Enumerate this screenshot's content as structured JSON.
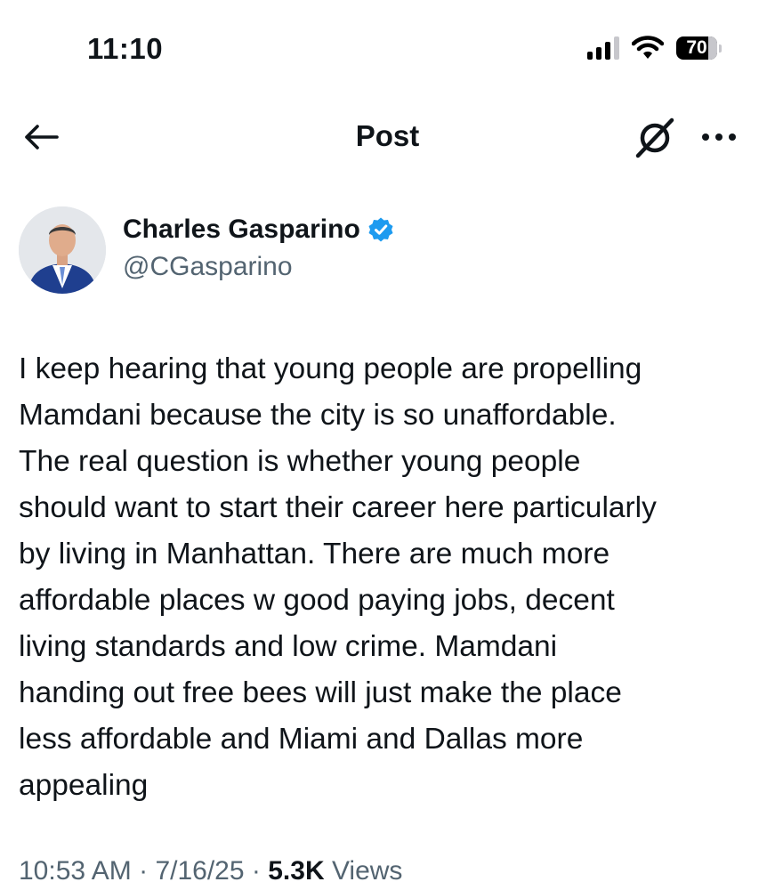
{
  "status_bar": {
    "time": "11:10",
    "battery": "70",
    "battery_level_percent": 70
  },
  "nav": {
    "title": "Post",
    "icons": [
      "back-arrow-icon",
      "grok-icon",
      "more-icon"
    ]
  },
  "author": {
    "name": "Charles Gasparino",
    "handle": "@CGasparino",
    "verified": true,
    "verified_color": "#1d9bf0"
  },
  "post": {
    "lines": [
      "I keep hearing that young people are propelling",
      "Mamdani because the city is so unaffordable.",
      "The real question is whether young people",
      "should want to start their career here particularly",
      "by living in Manhattan. There are much more",
      "affordable places w good paying jobs, decent",
      "living standards and low crime. Mamdani",
      "handing out free bees will just make the place",
      "less affordable and Miami and Dallas more",
      "appealing"
    ]
  },
  "meta": {
    "time": "10:53 AM",
    "separator": "·",
    "date": "7/16/25",
    "views_count": "5.3K",
    "views_label": "Views"
  },
  "colors": {
    "text": "#0f1419",
    "secondary": "#536471",
    "accent": "#1d9bf0"
  }
}
